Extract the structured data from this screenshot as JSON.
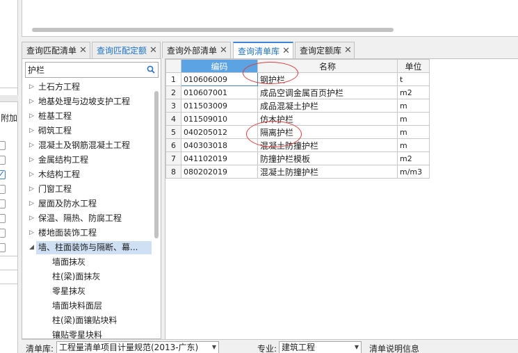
{
  "left_strip": {
    "header_label": "附加",
    "checkboxes": [
      false,
      false,
      true,
      false,
      false,
      false,
      false,
      false
    ]
  },
  "tabs": [
    {
      "label": "查询匹配清单",
      "state": "normal"
    },
    {
      "label": "查询匹配定额",
      "state": "blue"
    },
    {
      "label": "查询外部清单",
      "state": "normal"
    },
    {
      "label": "查询清单库",
      "state": "active"
    },
    {
      "label": "查询定额库",
      "state": "normal"
    }
  ],
  "tab_close": "✕",
  "search": {
    "value": "护栏"
  },
  "tree": [
    {
      "label": "土石方工程",
      "level": 0,
      "expanded": false
    },
    {
      "label": "地基处理与边坡支护工程",
      "level": 0,
      "expanded": false
    },
    {
      "label": "桩基工程",
      "level": 0,
      "expanded": false
    },
    {
      "label": "砌筑工程",
      "level": 0,
      "expanded": false
    },
    {
      "label": "混凝土及钢筋混凝土工程",
      "level": 0,
      "expanded": false
    },
    {
      "label": "金属结构工程",
      "level": 0,
      "expanded": false
    },
    {
      "label": "木结构工程",
      "level": 0,
      "expanded": false
    },
    {
      "label": "门窗工程",
      "level": 0,
      "expanded": false
    },
    {
      "label": "屋面及防水工程",
      "level": 0,
      "expanded": false
    },
    {
      "label": "保温、隔热、防腐工程",
      "level": 0,
      "expanded": false
    },
    {
      "label": "楼地面装饰工程",
      "level": 0,
      "expanded": false
    },
    {
      "label": "墙、柱面装饰与隔断、幕...",
      "level": 0,
      "expanded": true,
      "selected": true
    },
    {
      "label": "墙面抹灰",
      "level": 1
    },
    {
      "label": "柱(梁)面抹灰",
      "level": 1
    },
    {
      "label": "零星抹灰",
      "level": 1
    },
    {
      "label": "墙面块料面层",
      "level": 1
    },
    {
      "label": "柱(梁)面镶贴块料",
      "level": 1
    },
    {
      "label": "镶贴零星块料",
      "level": 1
    }
  ],
  "grid": {
    "headers": {
      "code": "编码",
      "name": "名称",
      "unit": "单位"
    },
    "rows": [
      {
        "num": "1",
        "code": "010606009",
        "name": "钢护栏",
        "unit": "t"
      },
      {
        "num": "2",
        "code": "010607001",
        "name": "成品空调金属百页护栏",
        "unit": "m2"
      },
      {
        "num": "3",
        "code": "011503009",
        "name": "成品混凝土护栏",
        "unit": "m"
      },
      {
        "num": "4",
        "code": "011509010",
        "name": "仿木护栏",
        "unit": "m"
      },
      {
        "num": "5",
        "code": "040205012",
        "name": "隔离护栏",
        "unit": "m"
      },
      {
        "num": "6",
        "code": "040303018",
        "name": "混凝土防撞护栏",
        "unit": "m"
      },
      {
        "num": "7",
        "code": "041102019",
        "name": "防撞护栏模板",
        "unit": "m2"
      },
      {
        "num": "8",
        "code": "080202019",
        "name": "混凝土防撞护栏",
        "unit": "m/m3"
      }
    ]
  },
  "bottom": {
    "library_label": "清单库:",
    "library_value": "工程量清单项目计量规范(2013-广东)",
    "specialty_label": "专业:",
    "specialty_value": "建筑工程",
    "info_link": "清单说明信息"
  },
  "colors": {
    "accent": "#3d86d6",
    "header_blue": "#5ba3e2",
    "annotation_red": "#e03a3a",
    "selection": "#cfe0f5"
  }
}
